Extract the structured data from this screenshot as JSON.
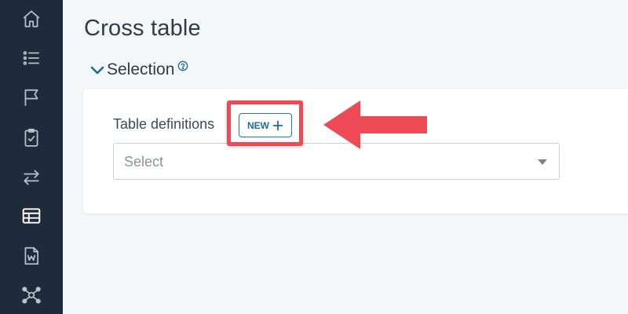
{
  "sidebar": {
    "items": [
      {
        "id": "home",
        "icon": "home-icon"
      },
      {
        "id": "list",
        "icon": "list-icon"
      },
      {
        "id": "flag",
        "icon": "flag-icon"
      },
      {
        "id": "clipboard",
        "icon": "clipboard-check-icon"
      },
      {
        "id": "transfer",
        "icon": "transfer-arrows-icon"
      },
      {
        "id": "table",
        "icon": "table-icon",
        "active": true
      },
      {
        "id": "word-doc",
        "icon": "word-document-icon"
      },
      {
        "id": "network",
        "icon": "network-icon"
      }
    ]
  },
  "page": {
    "title": "Cross table"
  },
  "section": {
    "label": "Selection",
    "help_icon": "help-circle-icon",
    "expanded": true
  },
  "table_definitions": {
    "label": "Table definitions",
    "new_button_label": "NEW",
    "select_placeholder": "Select"
  },
  "colors": {
    "sidebar_bg": "#1f2b3a",
    "accent": "#1f7aa8",
    "annotation": "#ee4a55",
    "page_bg": "#f3f7f8"
  }
}
